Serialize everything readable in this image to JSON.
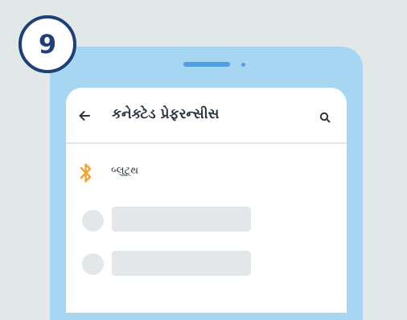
{
  "step": {
    "number": "9"
  },
  "app_bar": {
    "title": "કનેક્ટેડ પ્રેફરન્સીસ",
    "back_icon": "arrow-left-icon",
    "search_icon": "search-icon"
  },
  "list": {
    "items": [
      {
        "label": "બ્લુટૂથ",
        "icon": "bluetooth-icon"
      }
    ],
    "placeholder_rows": 2
  },
  "colors": {
    "background": "#e2e7e8",
    "badge_outline": "#1e3f78",
    "phone_body": "#a6d6f1",
    "speaker": "#4e9fe3",
    "screen": "#ffffff",
    "title_text": "#2b3540",
    "bluetooth_accent": "#f5a32a",
    "placeholder": "#e3e7ea"
  }
}
